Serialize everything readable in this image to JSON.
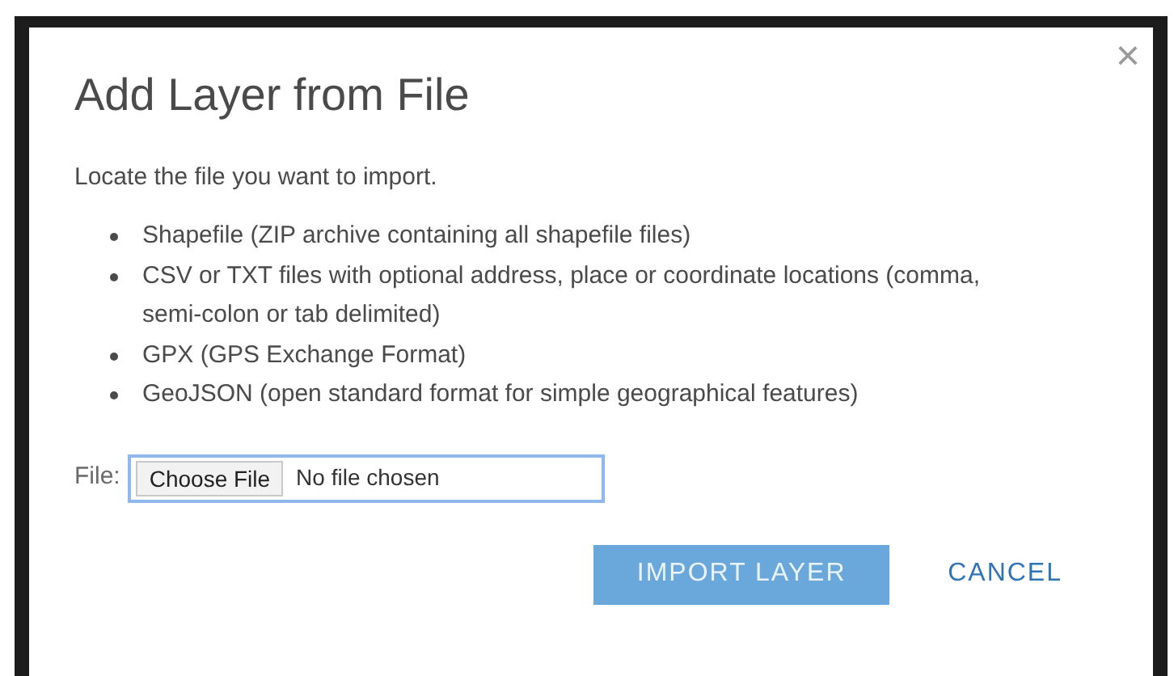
{
  "dialog": {
    "title": "Add Layer from File",
    "close": "×",
    "intro": "Locate the file you want to import.",
    "formats": [
      "Shapefile (ZIP archive containing all shapefile files)",
      "CSV or TXT files with optional address, place or coordinate locations (comma, semi-colon or tab delimited)",
      "GPX (GPS Exchange Format)",
      "GeoJSON (open standard format for simple geographical features)"
    ],
    "file": {
      "label": "File:",
      "button": "Choose File",
      "status": "No file chosen",
      "focused": true
    },
    "buttons": [
      {
        "kind": "primary",
        "label": "IMPORT LAYER",
        "disabled": true
      },
      {
        "kind": "link",
        "label": "CANCEL",
        "disabled": false
      }
    ]
  }
}
